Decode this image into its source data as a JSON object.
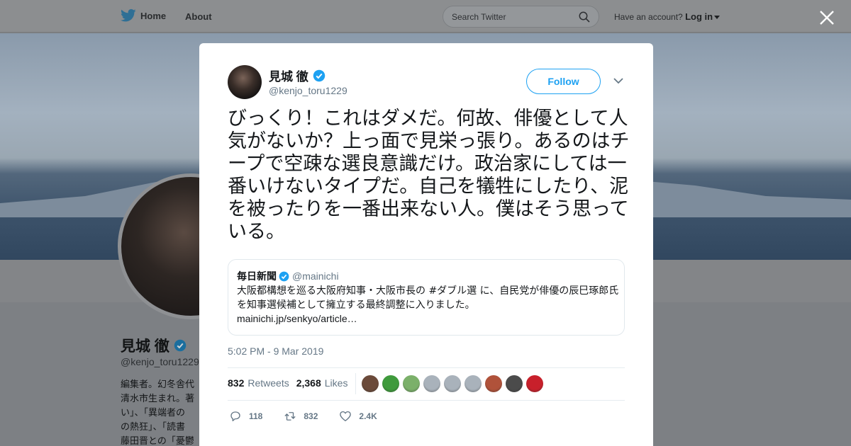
{
  "nav": {
    "home_label": "Home",
    "about_label": "About",
    "search_placeholder": "Search Twitter",
    "account_prompt": "Have an account?",
    "login_label": "Log in"
  },
  "background_profile": {
    "name": "見城 徹",
    "handle": "@kenjo_toru1229",
    "bio_lines": [
      "編集者。幻冬舎代",
      "清水市生まれ。著",
      "い」、「異端者の",
      "の熱狂」、「読書",
      "藤田晋との「憂鬱"
    ]
  },
  "tweet": {
    "author_name": "見城 徹",
    "author_handle": "@kenjo_toru1229",
    "follow_label": "Follow",
    "text": "びっくり！これはダメだ。何故、俳優として人気がないか？上っ面で見栄っ張り。あるのはチープで空疎な選良意識だけ。政治家にしては一番いけないタイプだ。自己を犠牲にしたり、泥を被ったりを一番出来ない人。僕はそう思っている。",
    "timestamp": "5:02 PM - 9 Mar 2019",
    "retweets_count": "832",
    "retweets_label": "Retweets",
    "likes_count": "2,368",
    "likes_label": "Likes",
    "liker_colors": [
      "#6b4a3a",
      "#3f9a3c",
      "#7bb06a",
      "#a9b2bb",
      "#a9b2bb",
      "#a9b2bb",
      "#b0523a",
      "#4b4b4b",
      "#c8202b"
    ],
    "actions": {
      "reply_count": "118",
      "retweet_count": "832",
      "like_count": "2.4K"
    }
  },
  "quote": {
    "name": "毎日新聞",
    "handle": "@mainichi",
    "body": "大阪都構想を巡る大阪府知事・大阪市長の #ダブル選 に、自民党が俳優の辰巳琢郎氏を知事選候補として擁立する最終調整に入りました。",
    "link": "mainichi.jp/senkyo/article…"
  },
  "colors": {
    "accent": "#1da1f2",
    "verified": "#1da1f2",
    "text_primary": "#14171a",
    "text_secondary": "#657786"
  },
  "icons": {
    "brand": "twitter-bird-icon",
    "search": "search-icon",
    "close": "close-icon",
    "verified": "verified-badge-icon",
    "menu": "chevron-down-icon",
    "reply": "reply-icon",
    "retweet": "retweet-icon",
    "like": "heart-icon"
  }
}
